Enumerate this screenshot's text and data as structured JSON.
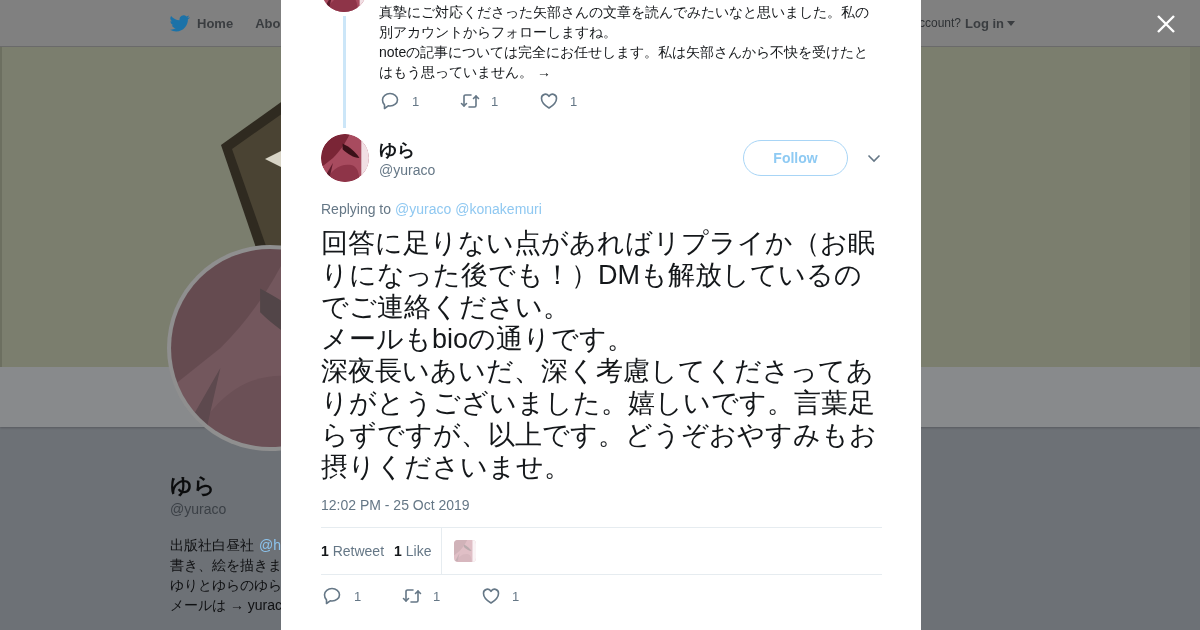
{
  "header": {
    "nav": [
      {
        "label": "Home",
        "kind": "home"
      },
      {
        "label": "Abo",
        "kind": "plain"
      }
    ],
    "account_prompt": "ccount?",
    "login": "Log in"
  },
  "profile": {
    "name": "ゆら",
    "handle": "@yuraco",
    "bio": [
      {
        "text": "出版社白昼社",
        "link": "@h"
      },
      {
        "text": "書き、絵を描きま"
      },
      {
        "text": "ゆりとゆらのゆら"
      },
      {
        "text": "メールは → yurac"
      }
    ]
  },
  "modal": {
    "previous_tweet": {
      "text_lines": [
        "真摯にご対応くださった矢部さんの文章を読んでみたいなと思いました。私の別アカウントからフォローしますね。",
        "noteの記事については完全にお任せします。私は矢部さんから不快を受けたとはもう思っていません。 →"
      ],
      "actions": [
        {
          "kind": "reply",
          "count": "1"
        },
        {
          "kind": "retweet",
          "count": "1"
        },
        {
          "kind": "like",
          "count": "1"
        }
      ]
    },
    "tweet": {
      "name": "ゆら",
      "handle": "@yuraco",
      "follow": "Follow",
      "replying_label": "Replying to",
      "replying_to": [
        "@yuraco",
        "@konakemuri"
      ],
      "text_lines": [
        "回答に足りない点があればリプライか（お眠りになった後でも！）DMも解放しているのでご連絡ください。",
        "メールもbioの通りです。",
        "深夜長いあいだ、深く考慮してくださってありがとうございました。嬉しいです。言葉足らずですが、以上です。どうぞおやすみもお摂りくださいませ。"
      ],
      "timestamp": "12:02 PM - 25 Oct 2019",
      "stats": [
        "**1** Retweet",
        "**1** Like"
      ],
      "actions": [
        {
          "kind": "reply",
          "count": "1"
        },
        {
          "kind": "retweet",
          "count": "1"
        },
        {
          "kind": "like",
          "count": "1"
        }
      ]
    }
  }
}
